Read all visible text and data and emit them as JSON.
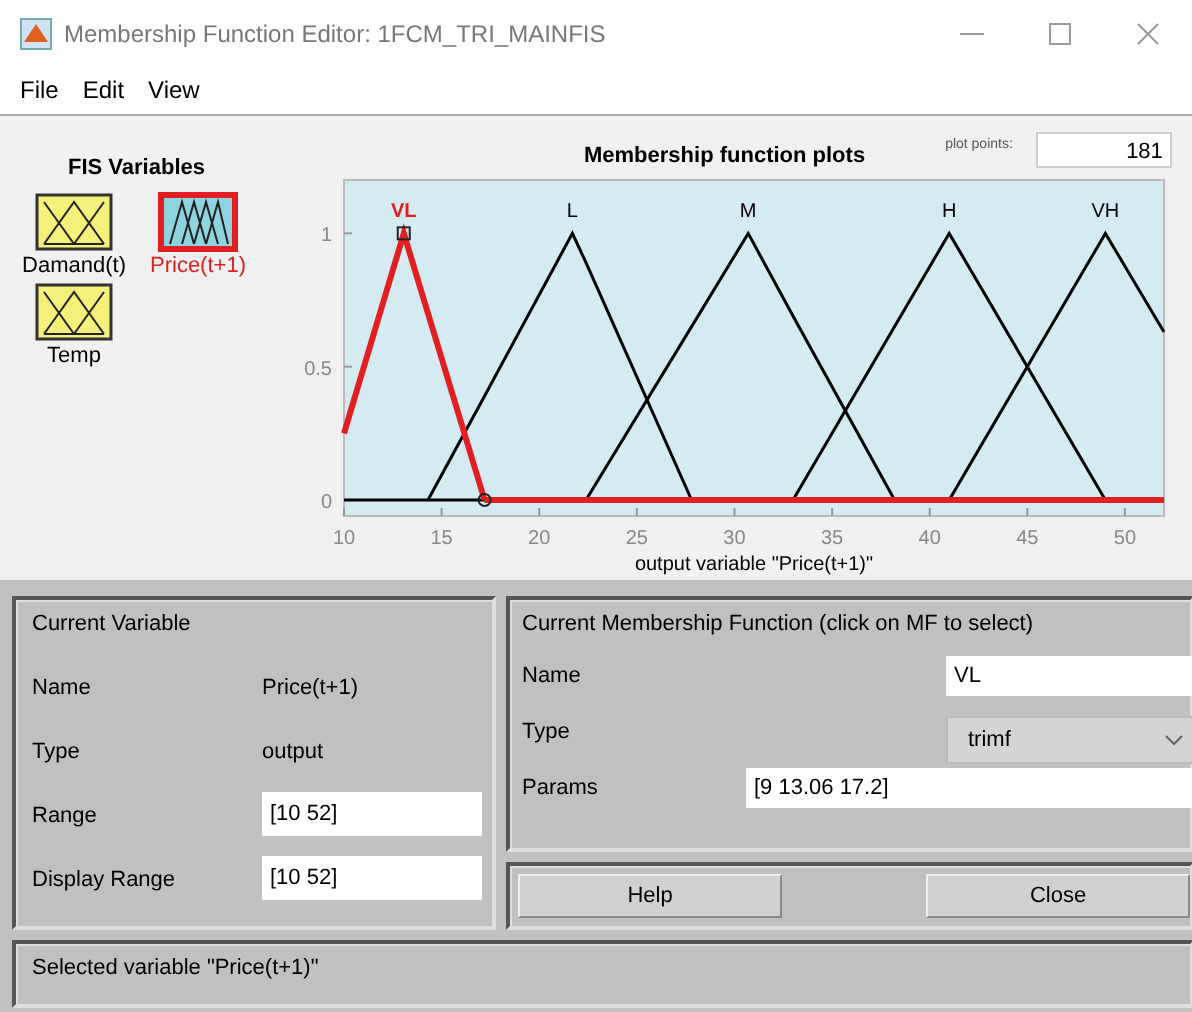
{
  "window": {
    "title": "Membership Function Editor: 1FCM_TRI_MAINFIS"
  },
  "menu": [
    "File",
    "Edit",
    "View"
  ],
  "fis_variables": {
    "title": "FIS Variables",
    "items": [
      {
        "label": "Damand(t)",
        "kind": "input",
        "selected": false
      },
      {
        "label": "Price(t+1)",
        "kind": "output",
        "selected": true
      },
      {
        "label": "Temp",
        "kind": "input",
        "selected": false
      }
    ]
  },
  "plot": {
    "plot_points_label": "plot points:",
    "plot_points": "181",
    "chart_data": {
      "type": "line",
      "title": "Membership function plots",
      "xlabel": "output variable \"Price(t+1)\"",
      "x": [
        10,
        13.06,
        14.3,
        17.2,
        21.7,
        22.4,
        27.8,
        30.7,
        33,
        38.2,
        41,
        49,
        52
      ],
      "series": [
        {
          "name": "VL",
          "color": "#e02020",
          "values": [
            0.25,
            1,
            0.7,
            0,
            0,
            0,
            0,
            0,
            0,
            0,
            0,
            0,
            0
          ]
        },
        {
          "name": "L",
          "color": "#000000",
          "values": [
            null,
            null,
            0,
            0.39,
            1,
            0.89,
            0,
            null,
            null,
            null,
            null,
            null,
            null
          ]
        },
        {
          "name": "M",
          "color": "#000000",
          "values": [
            null,
            null,
            null,
            null,
            null,
            0,
            0.65,
            1,
            0.69,
            0,
            null,
            null,
            null
          ]
        },
        {
          "name": "H",
          "color": "#000000",
          "values": [
            null,
            null,
            null,
            null,
            null,
            null,
            null,
            null,
            0,
            0.65,
            1,
            0,
            null
          ]
        },
        {
          "name": "VH",
          "color": "#000000",
          "values": [
            null,
            null,
            null,
            null,
            null,
            null,
            null,
            null,
            null,
            null,
            0,
            1,
            0.63
          ]
        }
      ],
      "xlim": [
        10,
        52
      ],
      "ylim": [
        -0.06,
        1.2
      ],
      "xticks": [
        10,
        15,
        20,
        25,
        30,
        35,
        40,
        45,
        50
      ],
      "yticks": [
        0,
        0.5,
        1
      ]
    },
    "curves": [
      {
        "selected": true
      },
      {
        "selected": false
      },
      {
        "selected": false
      },
      {
        "selected": false
      },
      {
        "selected": false
      }
    ]
  },
  "current_variable": {
    "title": "Current Variable",
    "name_label": "Name",
    "name": "Price(t+1)",
    "type_label": "Type",
    "type": "output",
    "range_label": "Range",
    "range": "[10 52]",
    "display_range_label": "Display Range",
    "display_range": "[10 52]"
  },
  "current_mf": {
    "title": "Current Membership Function (click on MF to select)",
    "name_label": "Name",
    "name": "VL",
    "type_label": "Type",
    "type": "trimf",
    "params_label": "Params",
    "params": "[9 13.06 17.2]"
  },
  "buttons": [
    "Help",
    "Close"
  ],
  "status_bar": "Selected variable \"Price(t+1)\""
}
